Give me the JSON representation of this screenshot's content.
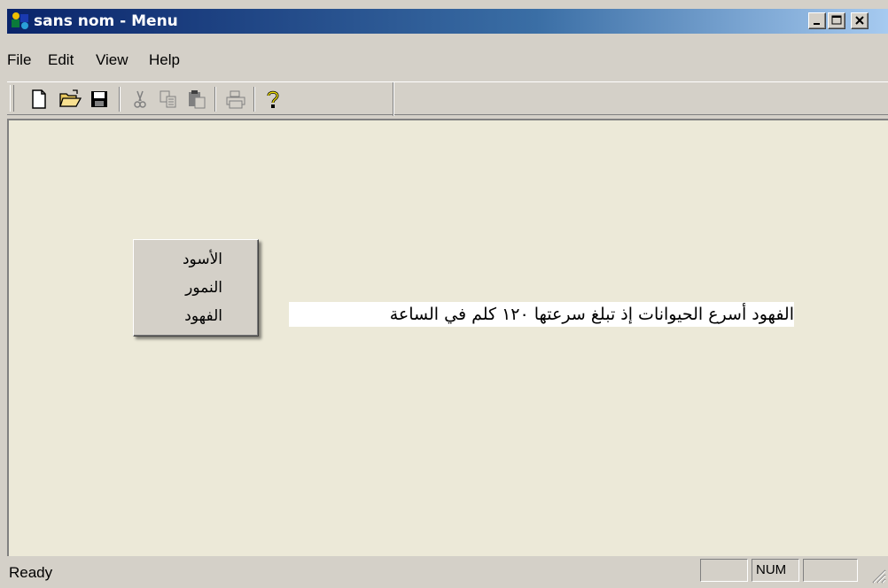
{
  "window": {
    "title": "sans nom - Menu",
    "controls": {
      "minimize": "minimize-icon",
      "maximize": "maximize-icon",
      "close": "close-icon"
    }
  },
  "menubar": {
    "items": [
      "File",
      "Edit",
      "View",
      "Help"
    ]
  },
  "toolbar": {
    "buttons": [
      "new-file-icon",
      "open-folder-icon",
      "save-disk-icon",
      "cut-icon",
      "copy-icon",
      "paste-icon",
      "print-icon",
      "help-icon"
    ]
  },
  "content": {
    "popup_items": [
      "الأسود",
      "النمور",
      "الفهود"
    ],
    "text_line": "الفهود أسرع الحيوانات إذ تبلغ سرعتها ١٢٠ كلم في الساعة"
  },
  "statusbar": {
    "text": "Ready",
    "indicators": [
      "",
      "NUM",
      ""
    ]
  },
  "colors": {
    "title_start": "#0a246a",
    "title_end": "#a6caf0",
    "face": "#d4d0c8",
    "client": "#ece9d8"
  }
}
